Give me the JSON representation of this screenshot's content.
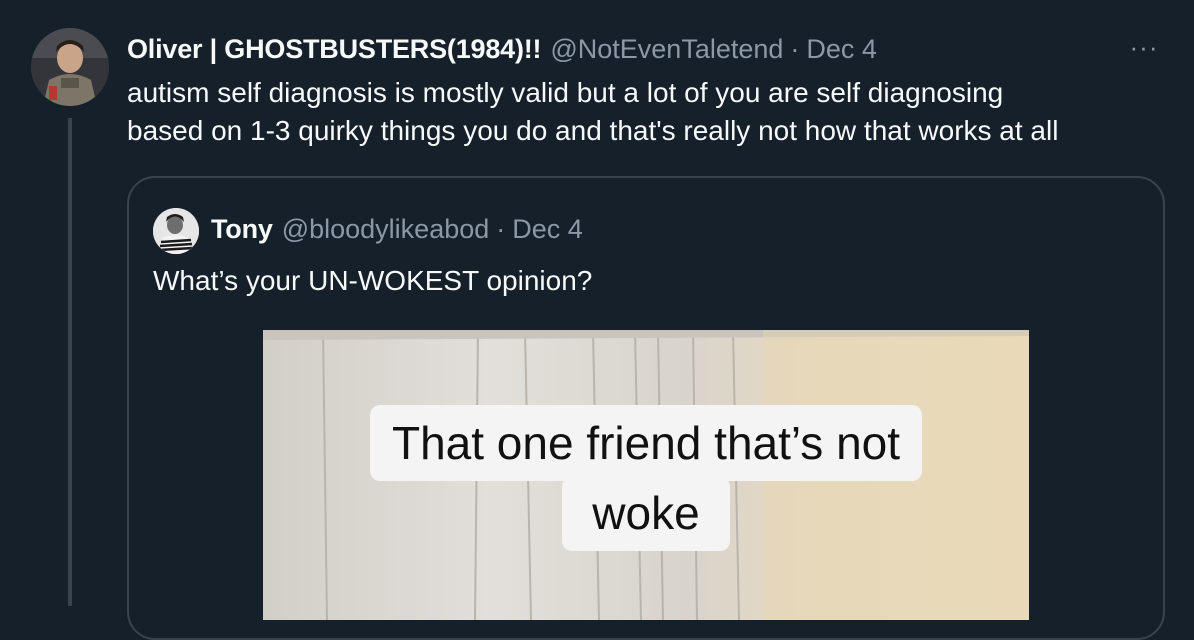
{
  "tweet": {
    "author_name": "Oliver | GHOSTBUSTERS(1984)!!",
    "author_handle": "@NotEvenTaletend",
    "separator": "·",
    "date": "Dec 4",
    "more_icon": "more-horizontal-icon",
    "more_glyph": "···",
    "text_line1": "autism self diagnosis is mostly valid but a lot of you are self diagnosing",
    "text_line2": "based on 1-3 quirky things you do and that's really not how that works at all"
  },
  "quote": {
    "author_name": "Tony",
    "author_handle": "@bloodylikeabod",
    "separator": "·",
    "date": "Dec 4",
    "text": "What’s your UN-WOKEST opinion?",
    "media": {
      "caption_line1": "That one friend that’s not",
      "caption_line2": "woke"
    }
  },
  "colors": {
    "background": "#15202b",
    "primary_text": "#f7f9f9",
    "secondary_text": "#8b98a5",
    "border": "#38444d"
  }
}
